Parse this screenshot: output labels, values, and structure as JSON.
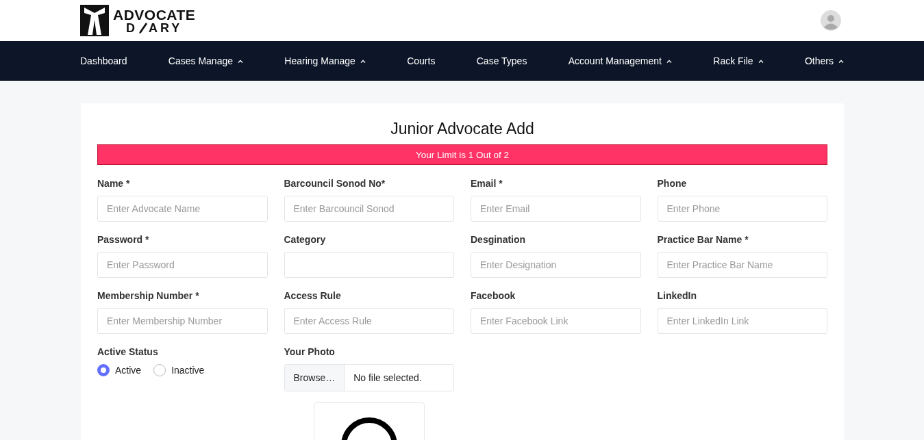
{
  "logo": {
    "top": "ADVOCATE",
    "bottom_start": "D",
    "bottom_end": "ARY"
  },
  "nav": [
    {
      "label": "Dashboard",
      "has_menu": false
    },
    {
      "label": "Cases Manage",
      "has_menu": true
    },
    {
      "label": "Hearing Manage",
      "has_menu": true
    },
    {
      "label": "Courts",
      "has_menu": false
    },
    {
      "label": "Case Types",
      "has_menu": false
    },
    {
      "label": "Account Management",
      "has_menu": true
    },
    {
      "label": "Rack File",
      "has_menu": true
    },
    {
      "label": "Others",
      "has_menu": true
    }
  ],
  "form": {
    "title": "Junior Advocate Add",
    "alert": "Your Limit is 1 Out of 2",
    "fields": [
      {
        "label": "Name *",
        "placeholder": "Enter Advocate Name"
      },
      {
        "label": "Barcouncil Sonod No*",
        "placeholder": "Enter Barcouncil Sonod"
      },
      {
        "label": "Email *",
        "placeholder": "Enter Email"
      },
      {
        "label": "Phone",
        "placeholder": "Enter Phone"
      },
      {
        "label": "Password *",
        "placeholder": "Enter Password"
      },
      {
        "label": "Category"
      },
      {
        "label": "Desgination",
        "placeholder": "Enter Designation"
      },
      {
        "label": "Practice Bar Name *",
        "placeholder": "Enter Practice Bar Name"
      },
      {
        "label": "Membership Number *",
        "placeholder": "Enter Membership Number"
      },
      {
        "label": "Access Rule",
        "placeholder": "Enter Access Rule"
      },
      {
        "label": "Facebook",
        "placeholder": "Enter Facebook Link"
      },
      {
        "label": "LinkedIn",
        "placeholder": "Enter LinkedIn Link"
      }
    ],
    "status": {
      "label": "Active Status",
      "options": [
        {
          "label": "Active",
          "selected": true
        },
        {
          "label": "Inactive",
          "selected": false
        }
      ]
    },
    "photo": {
      "label": "Your Photo",
      "button": "Browse…",
      "file_text": "No file selected."
    }
  }
}
